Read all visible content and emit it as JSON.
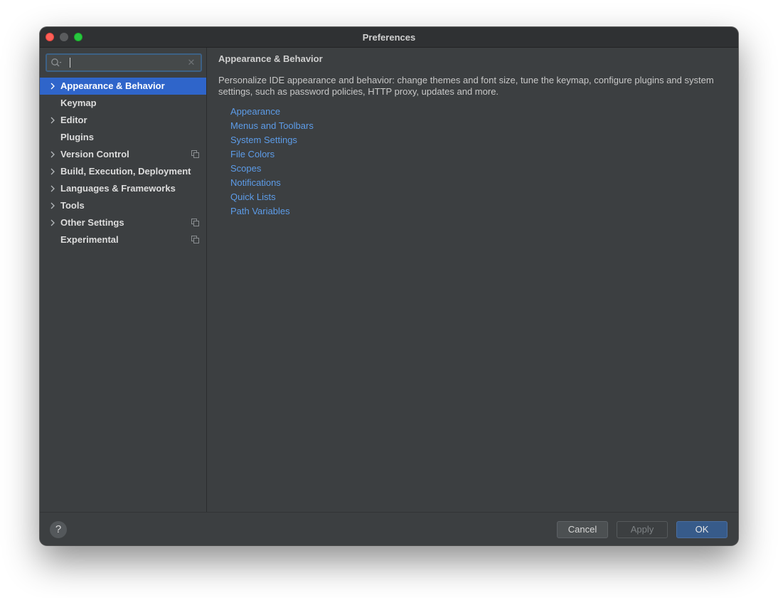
{
  "window": {
    "title": "Preferences"
  },
  "search": {
    "value": "",
    "placeholder": ""
  },
  "sidebar": {
    "items": [
      {
        "label": "Appearance & Behavior",
        "expandable": true,
        "selected": true,
        "project_icon": false
      },
      {
        "label": "Keymap",
        "expandable": false,
        "selected": false,
        "project_icon": false
      },
      {
        "label": "Editor",
        "expandable": true,
        "selected": false,
        "project_icon": false
      },
      {
        "label": "Plugins",
        "expandable": false,
        "selected": false,
        "project_icon": false
      },
      {
        "label": "Version Control",
        "expandable": true,
        "selected": false,
        "project_icon": true
      },
      {
        "label": "Build, Execution, Deployment",
        "expandable": true,
        "selected": false,
        "project_icon": false
      },
      {
        "label": "Languages & Frameworks",
        "expandable": true,
        "selected": false,
        "project_icon": false
      },
      {
        "label": "Tools",
        "expandable": true,
        "selected": false,
        "project_icon": false
      },
      {
        "label": "Other Settings",
        "expandable": true,
        "selected": false,
        "project_icon": true
      },
      {
        "label": "Experimental",
        "expandable": false,
        "selected": false,
        "project_icon": true
      }
    ]
  },
  "main": {
    "title": "Appearance & Behavior",
    "description": "Personalize IDE appearance and behavior: change themes and font size, tune the keymap, configure plugins and system settings, such as password policies, HTTP proxy, updates and more.",
    "links": [
      "Appearance",
      "Menus and Toolbars",
      "System Settings",
      "File Colors",
      "Scopes",
      "Notifications",
      "Quick Lists",
      "Path Variables"
    ]
  },
  "footer": {
    "help_label": "?",
    "cancel_label": "Cancel",
    "apply_label": "Apply",
    "ok_label": "OK"
  },
  "colors": {
    "window_bg": "#3c3f41",
    "selection": "#2f65ca",
    "link": "#5d9ce8",
    "ok_button": "#375b8a"
  },
  "icons": {
    "search": "search-icon",
    "clear": "clear-icon",
    "chevron": "chevron-right-icon",
    "project": "project-level-icon",
    "help": "help-icon"
  }
}
